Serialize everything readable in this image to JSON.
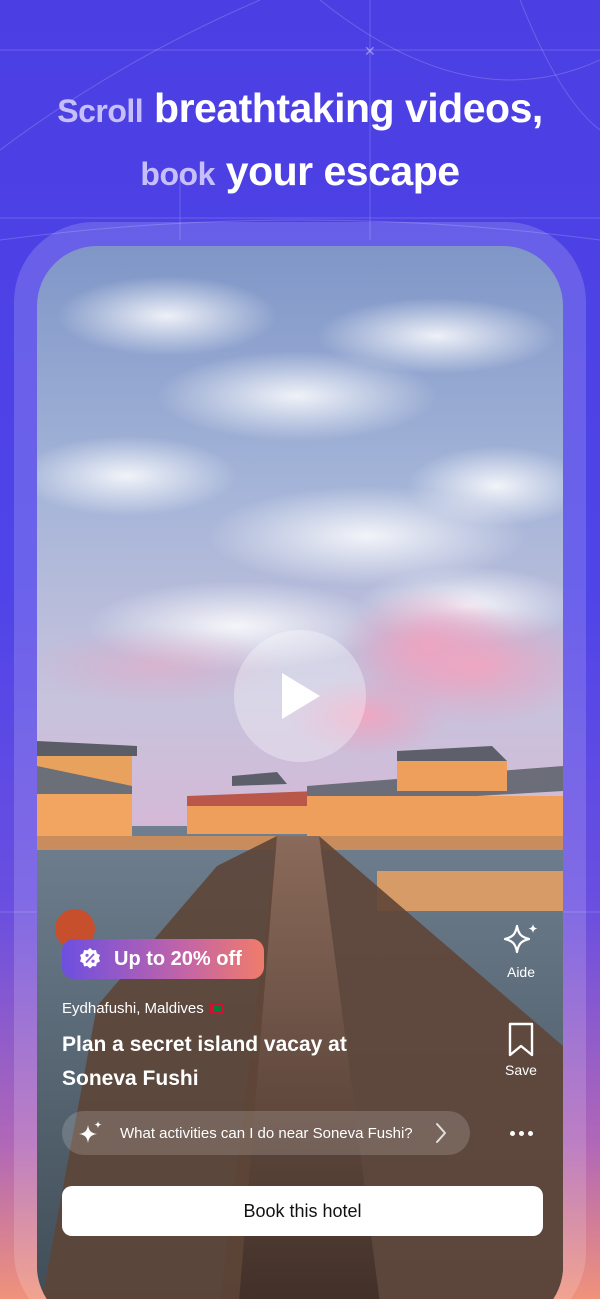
{
  "headline": {
    "line1_muted": "Scroll",
    "line1_bold": "breathtaking videos,",
    "line2_muted": "book",
    "line2_bold": "your escape"
  },
  "video": {
    "play_icon": "play-icon",
    "offer_badge": "Up to 20% off",
    "offer_icon": "percent-badge-icon",
    "location": "Eydhafushi, Maldives",
    "location_flag": "maldives-flag-icon",
    "title": "Plan a secret island vacay at Soneva Fushi"
  },
  "side_actions": {
    "aide_label": "Aide",
    "aide_icon": "sparkle-icon",
    "save_label": "Save",
    "save_icon": "bookmark-icon",
    "more_icon": "more-dots-icon"
  },
  "prompt": {
    "text": "What activities can I do near Soneva Fushi?",
    "icon": "sparkles-icon",
    "chevron": "chevron-right-icon"
  },
  "cta": {
    "book_label": "Book this hotel"
  },
  "colors": {
    "background_top": "#4b3fe3",
    "background_bottom": "#f0927a",
    "badge_start": "#6d4fe0",
    "badge_end": "#f07c6a"
  }
}
